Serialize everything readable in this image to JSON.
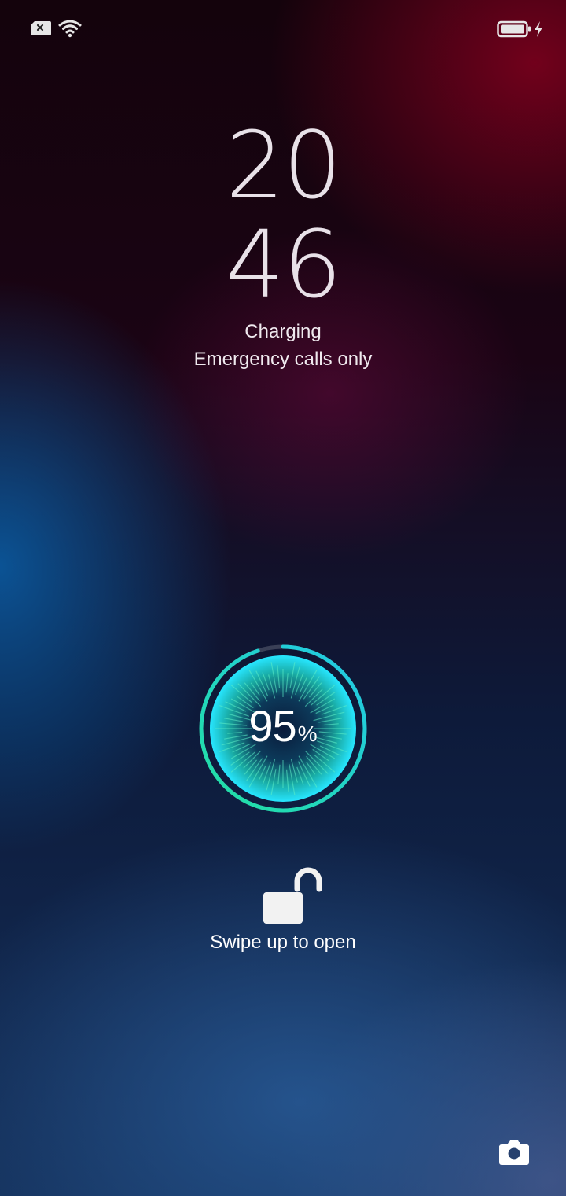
{
  "status_bar": {
    "sim_icon": "sim-card-no-service-icon",
    "wifi_icon": "wifi-icon",
    "battery_icon": "battery-icon",
    "charging_icon": "lightning-bolt-icon"
  },
  "clock": {
    "hours": "20",
    "minutes": "46"
  },
  "status": {
    "charging": "Charging",
    "network": "Emergency calls only"
  },
  "battery": {
    "percent_value": "95",
    "percent_sign": "%",
    "level_fraction": 0.95
  },
  "lock": {
    "icon": "unlocked-padlock-icon",
    "hint": "Swipe up to open"
  },
  "shortcut": {
    "icon": "camera-icon"
  },
  "colors": {
    "ring_start": "#22e0a0",
    "ring_end": "#22c8e8",
    "core_glow": "#27e6ff"
  }
}
